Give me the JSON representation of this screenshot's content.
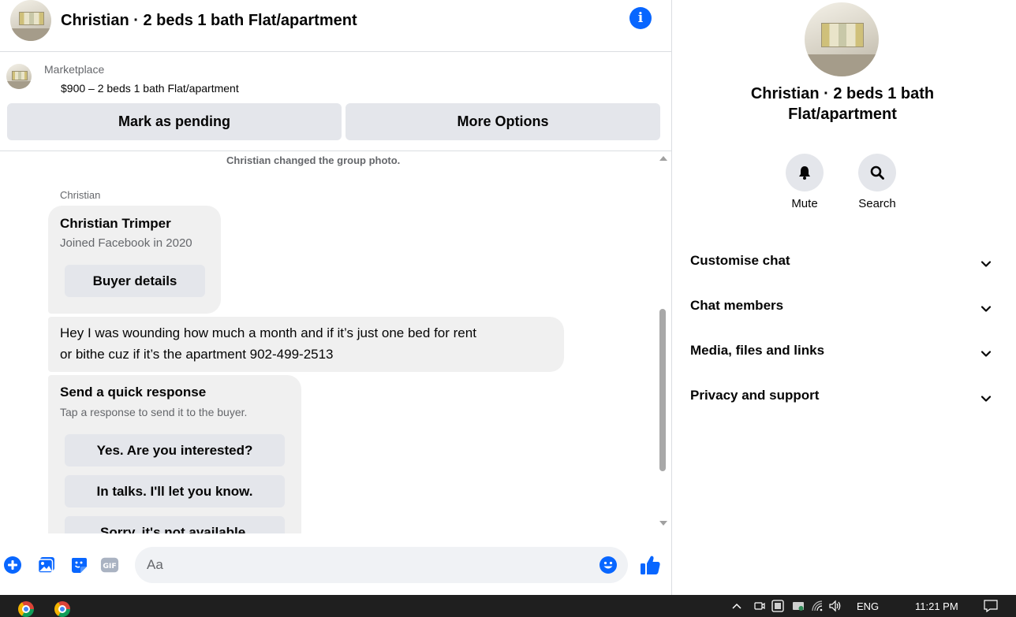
{
  "header": {
    "title": "Christian · 2 beds 1 bath Flat/apartment",
    "info_icon_glyph": "i"
  },
  "listing": {
    "source": "Marketplace",
    "description": "$900 – 2 beds 1 bath Flat/apartment",
    "mark_pending_label": "Mark as pending",
    "more_options_label": "More Options"
  },
  "messages": {
    "system_event": "Christian changed the group photo.",
    "sender_name": "Christian",
    "profile_card": {
      "name": "Christian Trimper",
      "joined": "Joined Facebook in 2020",
      "button_label": "Buyer details"
    },
    "text_message": {
      "line1": "Hey I was wounding how much a month and if it’s just one bed for rent",
      "line2": "or bithe cuz if it’s the apartment 902-499-2513"
    },
    "quick_response": {
      "title": "Send a quick response",
      "subtitle": "Tap a response to send it to the buyer.",
      "options": [
        "Yes. Are you interested?",
        "In talks. I'll let you know.",
        "Sorry, it's not available."
      ]
    }
  },
  "composer": {
    "placeholder": "Aa",
    "icons": [
      "plus-icon",
      "photo-icon",
      "sticker-icon",
      "gif-icon",
      "emoji-icon",
      "like-icon"
    ],
    "gif_text": "GIF"
  },
  "sidebar": {
    "name": "Christian · 2 beds 1 bath Flat/apartment",
    "name_line1": "Christian · 2 beds 1 bath",
    "name_line2": "Flat/apartment",
    "actions": [
      {
        "label": "Mute",
        "icon": "bell-icon"
      },
      {
        "label": "Search",
        "icon": "search-icon"
      }
    ],
    "menu": [
      "Customise chat",
      "Chat members",
      "Media, files and links",
      "Privacy and support"
    ]
  },
  "taskbar": {
    "apps": [
      "chrome-icon",
      "chrome-icon"
    ],
    "language": "ENG",
    "time": "11:21 PM"
  },
  "colors": {
    "accent": "#0866ff",
    "button_bg": "#e4e6eb",
    "bubble_bg": "#f0f0f0",
    "secondary_text": "#65676b",
    "taskbar_bg": "#1f1f1f"
  }
}
